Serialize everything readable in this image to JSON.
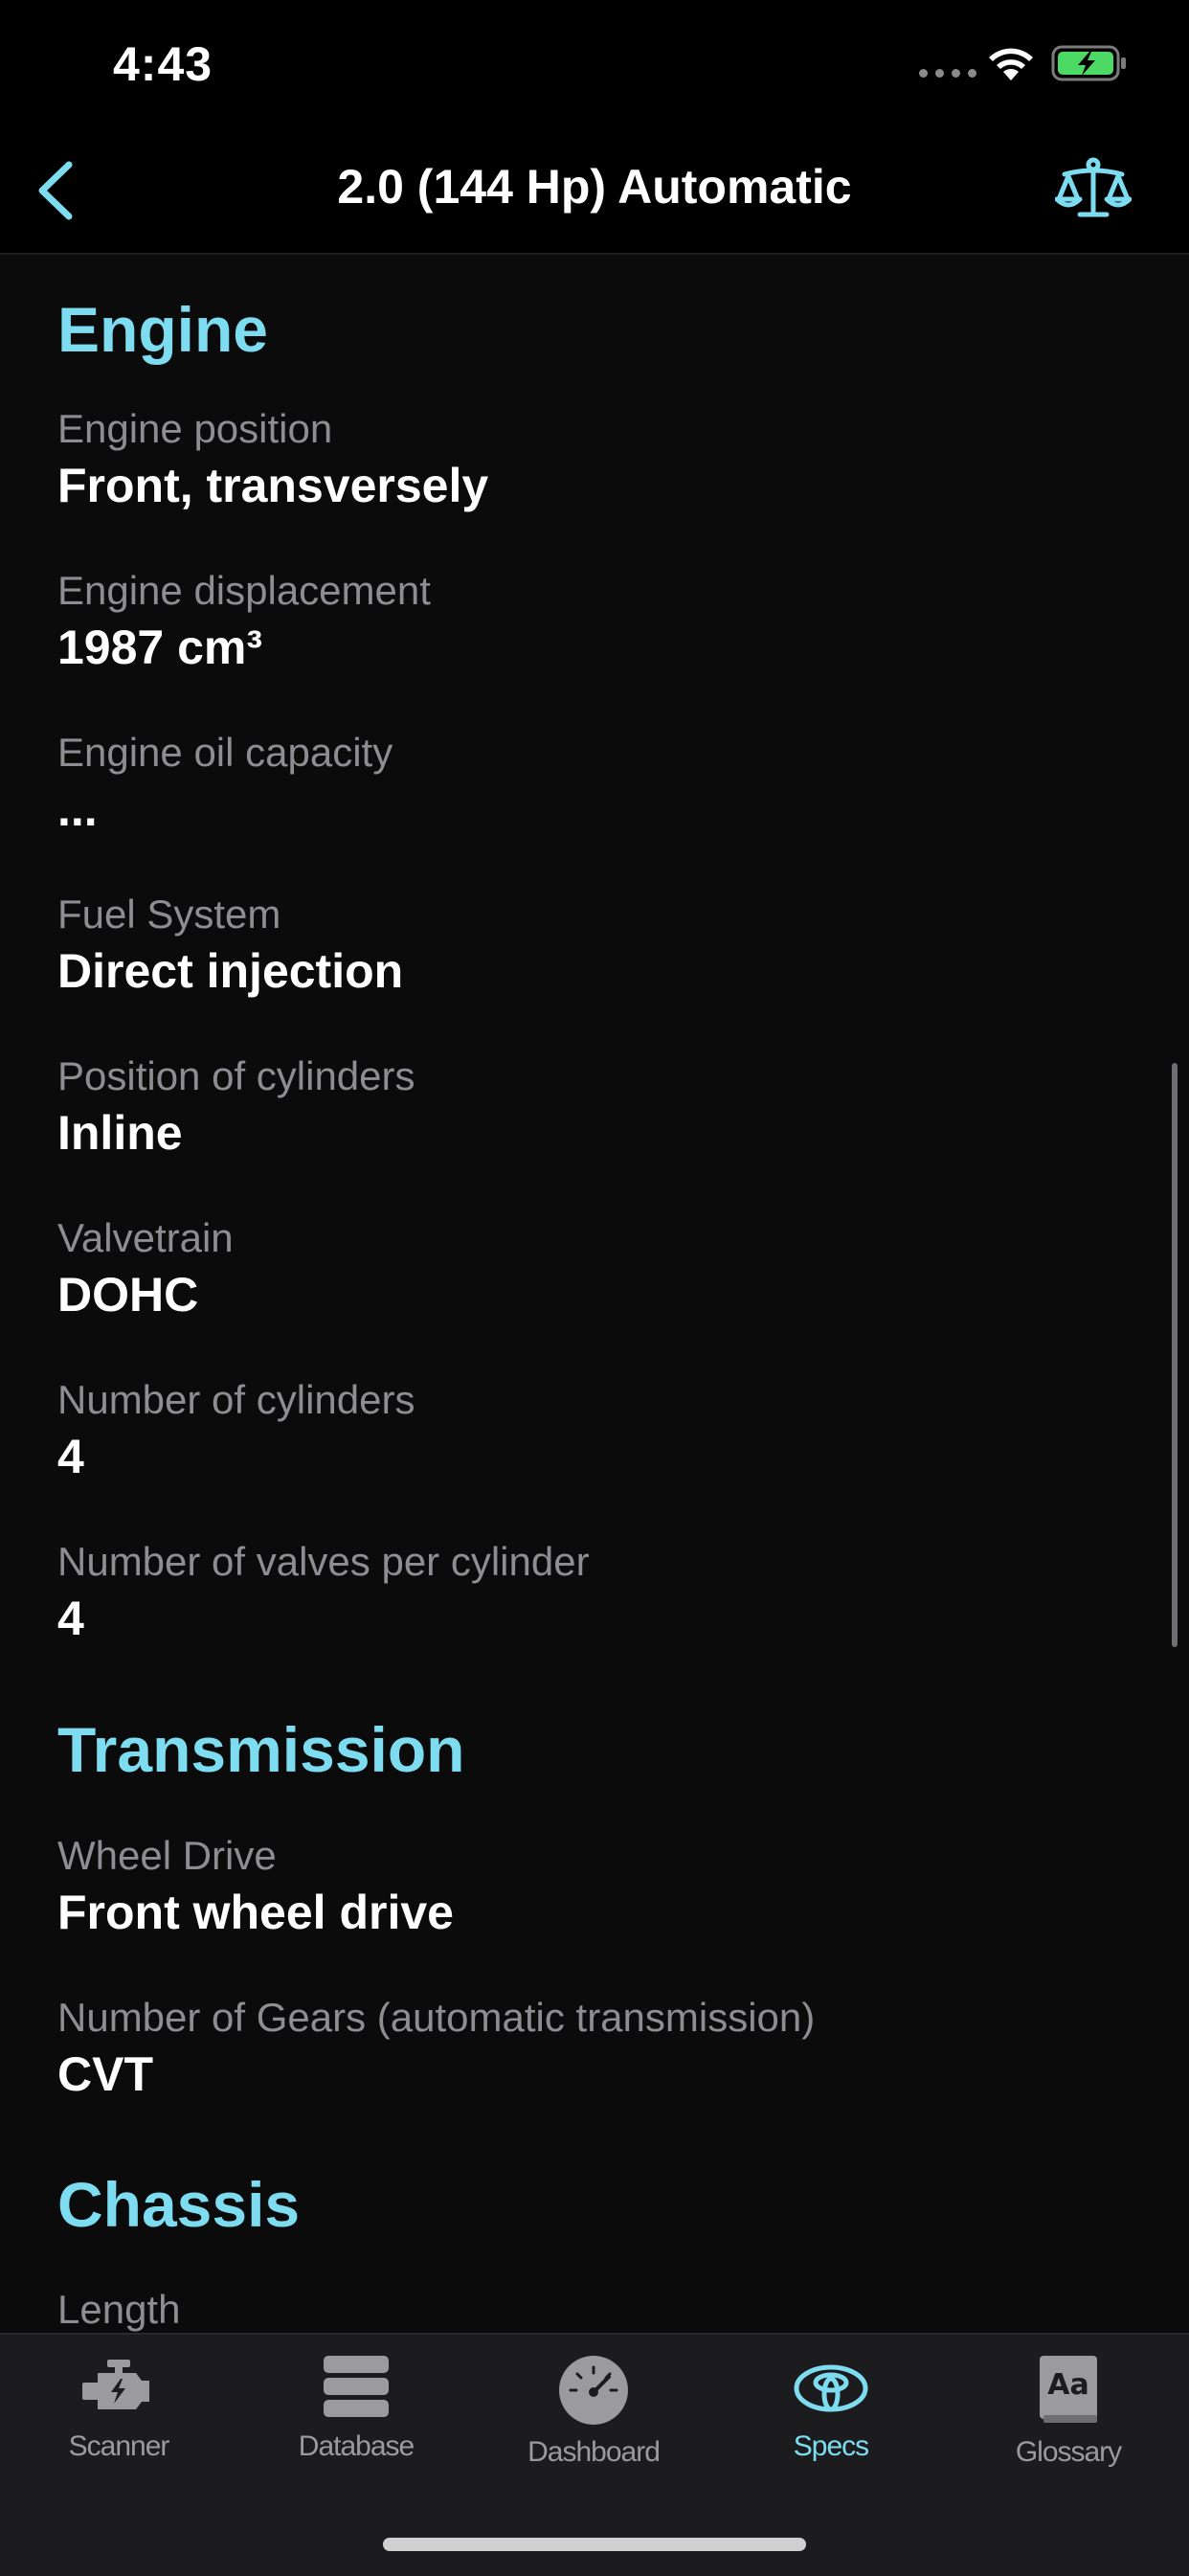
{
  "status_bar": {
    "time": "4:43"
  },
  "nav": {
    "title": "2.0 (144 Hp) Automatic",
    "back_icon": "chevron-left-icon",
    "compare_icon": "scales-icon"
  },
  "sections": {
    "engine": {
      "title": "Engine",
      "items": [
        {
          "label": "Engine position",
          "value": "Front, transversely"
        },
        {
          "label": "Engine displacement",
          "value": "1987 cm³"
        },
        {
          "label": "Engine oil capacity",
          "value": "..."
        },
        {
          "label": "Fuel System",
          "value": "Direct injection"
        },
        {
          "label": "Position of cylinders",
          "value": "Inline"
        },
        {
          "label": "Valvetrain",
          "value": "DOHC"
        },
        {
          "label": "Number of cylinders",
          "value": "4"
        },
        {
          "label": "Number of valves per cylinder",
          "value": "4"
        }
      ]
    },
    "transmission": {
      "title": "Transmission",
      "items": [
        {
          "label": "Wheel Drive",
          "value": "Front wheel drive"
        },
        {
          "label": "Number of Gears (automatic transmission)",
          "value": "CVT"
        }
      ]
    },
    "chassis": {
      "title": "Chassis",
      "items": [
        {
          "label": "Length"
        }
      ]
    }
  },
  "tabs": [
    {
      "label": "Scanner",
      "icon": "engine-icon"
    },
    {
      "label": "Database",
      "icon": "database-icon"
    },
    {
      "label": "Dashboard",
      "icon": "gauge-icon"
    },
    {
      "label": "Specs",
      "icon": "car-logo-icon",
      "active": true
    },
    {
      "label": "Glossary",
      "icon": "dictionary-icon"
    }
  ],
  "colors": {
    "accent": "#7ddcf0",
    "background": "#0b0b0c",
    "label": "#8d8d92",
    "tab_bar": "#1c1c1e"
  }
}
